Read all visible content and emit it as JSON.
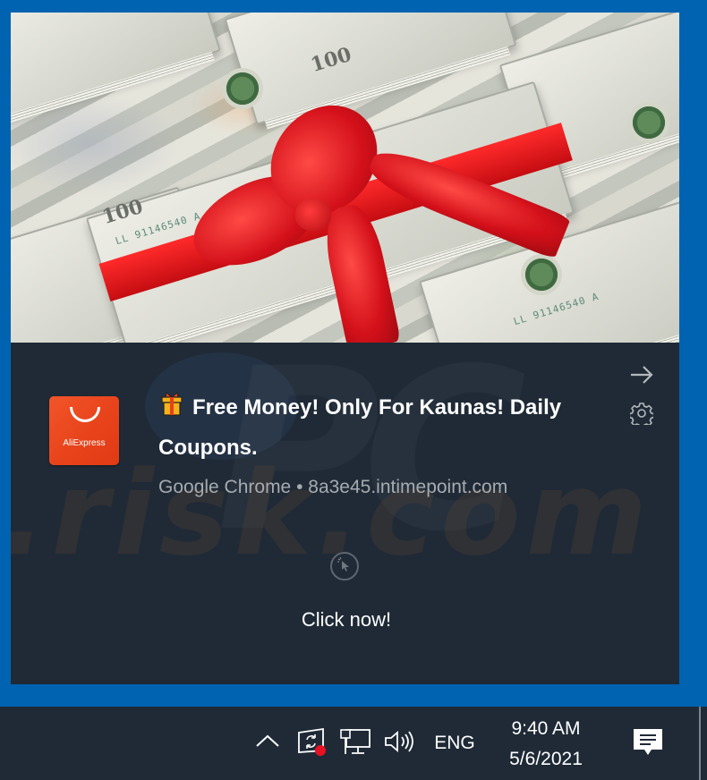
{
  "notification": {
    "hero_image_alt": "Stack of $100 bills wrapped with a red ribbon bow",
    "app_logo_text": "AliExpress",
    "title_emoji": "gift-icon",
    "title": "Free Money! Only For Kaunas! Daily Coupons.",
    "source": "Google Chrome • 8a3e45.intimepoint.com",
    "action_label": "Click now!",
    "dismiss_icon": "arrow-right-icon",
    "settings_icon": "gear-icon",
    "hero_decor": {
      "denomination": "100",
      "serial": "LL 91146540 A"
    }
  },
  "watermark": {
    "text": ".risk.com",
    "logo": "PC"
  },
  "taskbar": {
    "tray": {
      "show_hidden_icon": "chevron-up-icon",
      "sync_icon": "sync-alert-icon",
      "network_icon": "network-icon",
      "volume_icon": "volume-icon",
      "language": "ENG"
    },
    "clock": {
      "time": "9:40 AM",
      "date": "5/6/2021"
    },
    "notifications_icon": "action-center-icon"
  },
  "colors": {
    "accent_blue": "#0063b1",
    "panel_bg": "#1f2a36",
    "aliexpress_orange": "#e8431b",
    "alert_red": "#e81123"
  }
}
